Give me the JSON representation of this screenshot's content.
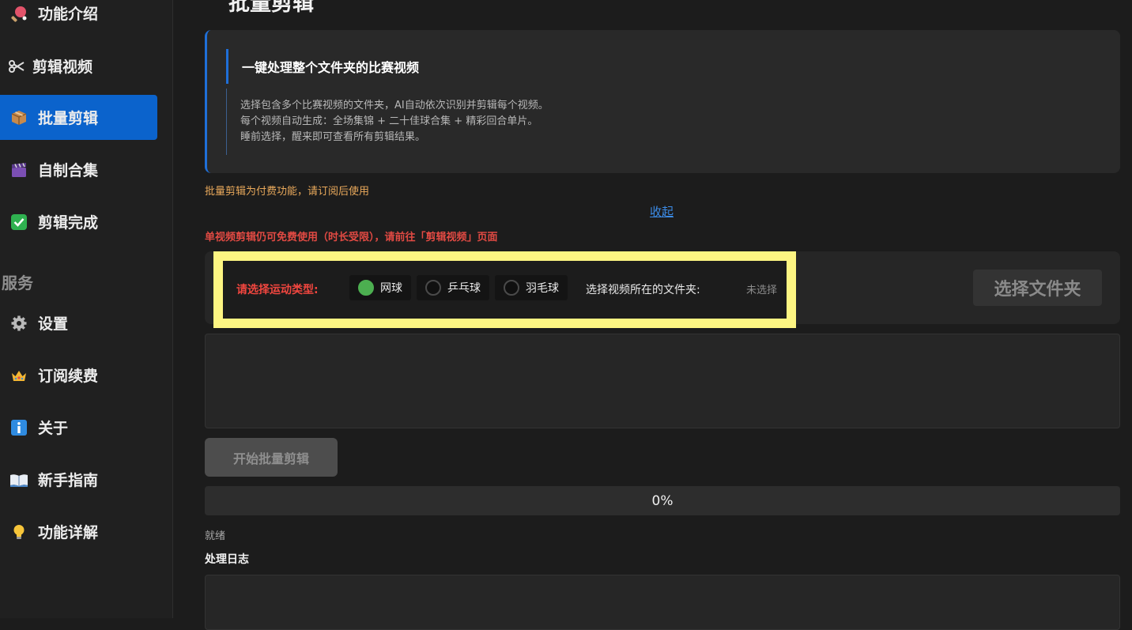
{
  "sidebar": {
    "items": [
      {
        "label": "功能介绍",
        "icon": "ping-pong-icon"
      },
      {
        "label": "剪辑视频",
        "icon": "scissors-icon"
      },
      {
        "label": "批量剪辑",
        "icon": "package-icon",
        "active": true
      },
      {
        "label": "自制合集",
        "icon": "clapper-icon"
      },
      {
        "label": "剪辑完成",
        "icon": "check-box-icon"
      }
    ],
    "section_label": "服务",
    "service_items": [
      {
        "label": "设置",
        "icon": "gear-icon"
      },
      {
        "label": "订阅续费",
        "icon": "crown-icon"
      },
      {
        "label": "关于",
        "icon": "info-icon"
      },
      {
        "label": "新手指南",
        "icon": "book-icon"
      },
      {
        "label": "功能详解",
        "icon": "bulb-icon"
      }
    ]
  },
  "main": {
    "title": "批量剪辑",
    "info": {
      "title": "一键处理整个文件夹的比赛视频",
      "lines": [
        "选择包含多个比赛视频的文件夹，AI自动依次识别并剪辑每个视频。",
        "每个视频自动生成：全场集锦 + 二十佳球合集 + 精彩回合单片。",
        "睡前选择，醒来即可查看所有剪辑结果。"
      ]
    },
    "paid_note": "批量剪辑为付费功能，请订阅后使用",
    "collapse_link": "收起",
    "free_note": "单视频剪辑仍可免费使用（时长受限），请前往「剪辑视频」页面",
    "sport": {
      "label": "请选择运动类型:",
      "options": [
        {
          "label": "网球",
          "selected": true
        },
        {
          "label": "乒乓球",
          "selected": false
        },
        {
          "label": "羽毛球",
          "selected": false
        }
      ]
    },
    "folder": {
      "label": "选择视频所在的文件夹:",
      "value": "未选择",
      "button": "选择文件夹"
    },
    "start_button": "开始批量剪辑",
    "progress": {
      "value": 0,
      "text": "0%"
    },
    "status": "就绪",
    "log_title": "处理日志"
  },
  "colors": {
    "accent": "#0b63cc",
    "highlight": "#fdf582",
    "warning": "#e9a95b",
    "error": "#e24a43",
    "radio_on": "#4caf50"
  }
}
